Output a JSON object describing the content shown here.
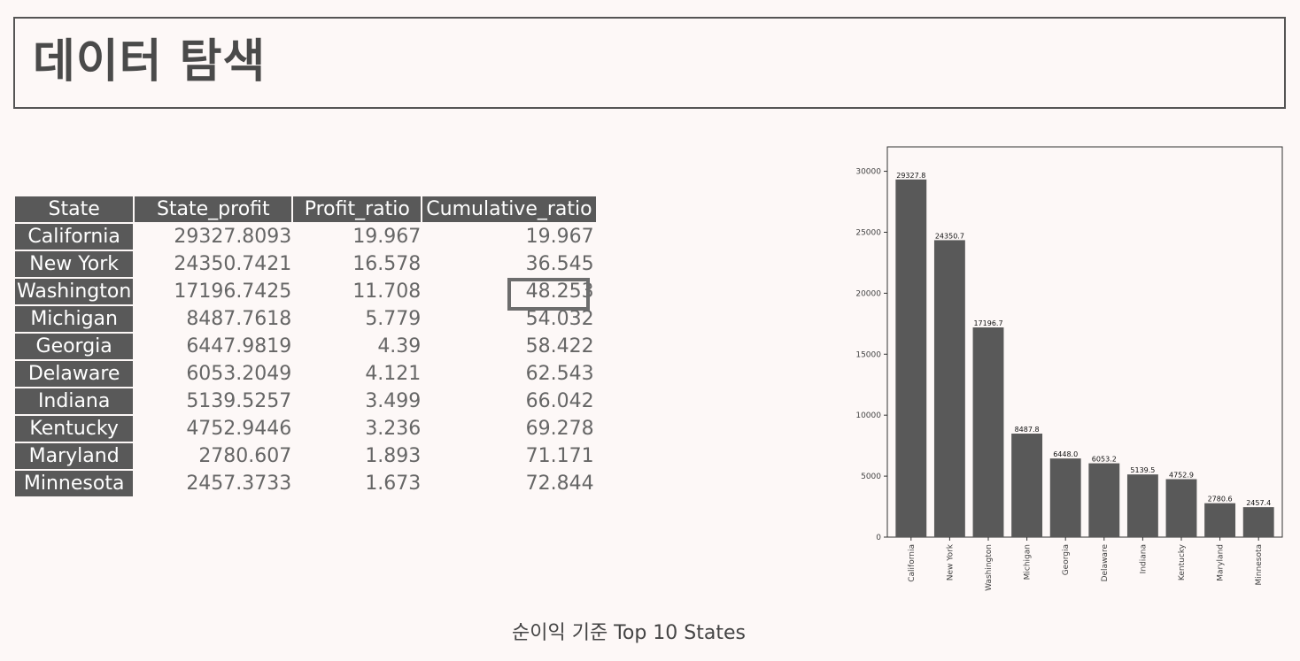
{
  "header": {
    "title": "데이터 탐색"
  },
  "table": {
    "columns": [
      "State",
      "State_profit",
      "Profit_ratio",
      "Cumulative_ratio"
    ],
    "rows": [
      [
        "California",
        "29327.8093",
        "19.967",
        "19.967"
      ],
      [
        "New York",
        "24350.7421",
        "16.578",
        "36.545"
      ],
      [
        "Washington",
        "17196.7425",
        "11.708",
        "48.253"
      ],
      [
        "Michigan",
        "8487.7618",
        "5.779",
        "54.032"
      ],
      [
        "Georgia",
        "6447.9819",
        "4.39",
        "58.422"
      ],
      [
        "Delaware",
        "6053.2049",
        "4.121",
        "62.543"
      ],
      [
        "Indiana",
        "5139.5257",
        "3.499",
        "66.042"
      ],
      [
        "Kentucky",
        "4752.9446",
        "3.236",
        "69.278"
      ],
      [
        "Maryland",
        "2780.607",
        "1.893",
        "71.171"
      ],
      [
        "Minnesota",
        "2457.3733",
        "1.673",
        "72.844"
      ]
    ]
  },
  "caption": "순이익 기준 Top 10 States",
  "chart_data": {
    "type": "bar",
    "categories": [
      "California",
      "New York",
      "Washington",
      "Michigan",
      "Georgia",
      "Delaware",
      "Indiana",
      "Kentucky",
      "Maryland",
      "Minnesota"
    ],
    "values": [
      29327.8,
      24350.7,
      17196.7,
      8487.8,
      6448.0,
      6053.2,
      5139.5,
      4752.9,
      2780.6,
      2457.4
    ],
    "labels": [
      "29327.8",
      "24350.7",
      "17196.7",
      "8487.8",
      "6448.0",
      "6053.2",
      "5139.5",
      "4752.9",
      "2780.6",
      "2457.4"
    ],
    "yticks": [
      0,
      5000,
      10000,
      15000,
      20000,
      25000,
      30000
    ],
    "ylim": [
      0,
      32000
    ],
    "bar_color": "#595959",
    "grid": false
  }
}
